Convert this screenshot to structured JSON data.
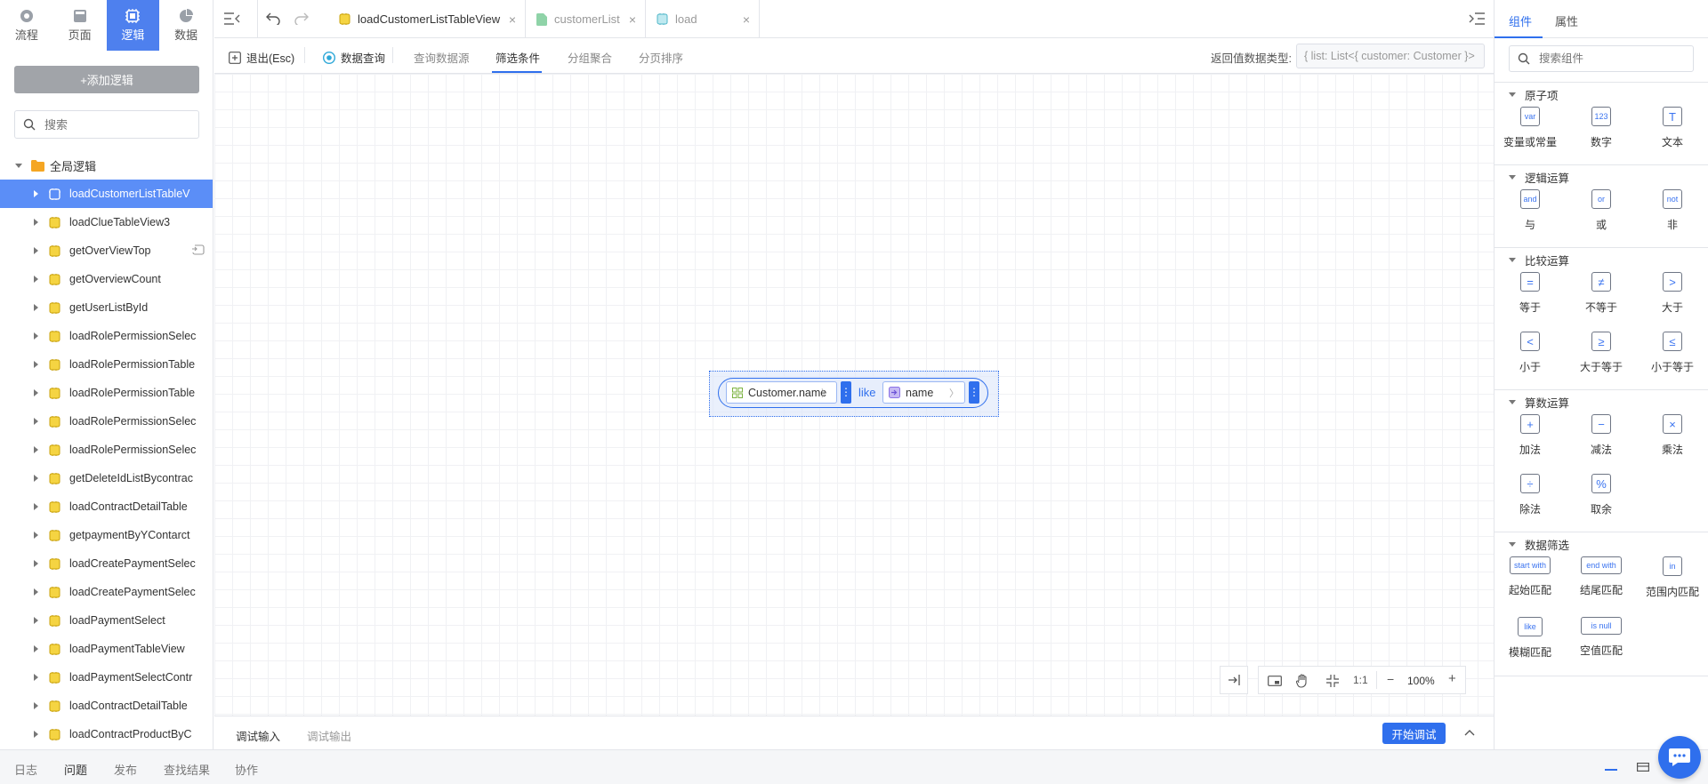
{
  "mode_tabs": [
    {
      "label": "流程",
      "icon": "flow-icon"
    },
    {
      "label": "页面",
      "icon": "page-icon"
    },
    {
      "label": "逻辑",
      "icon": "logic-icon"
    },
    {
      "label": "数据",
      "icon": "data-icon"
    }
  ],
  "left_panel": {
    "add_logic_label": "+添加逻辑",
    "search_placeholder": "搜索",
    "tree_root": "全局逻辑",
    "items": [
      "loadCustomerListTableV",
      "loadClueTableView3",
      "getOverViewTop",
      "getOverviewCount",
      "getUserListById",
      "loadRolePermissionSelec",
      "loadRolePermissionTable",
      "loadRolePermissionTable",
      "loadRolePermissionSelec",
      "loadRolePermissionSelec",
      "getDeleteIdListBycontrac",
      "loadContractDetailTable",
      "getpaymentByYContarct",
      "loadCreatePaymentSelec",
      "loadCreatePaymentSelec",
      "loadPaymentSelect",
      "loadPaymentTableView",
      "loadPaymentSelectContr",
      "loadContractDetailTable",
      "loadContractProductByC"
    ]
  },
  "editor_tabs": [
    {
      "label": "loadCustomerListTableView",
      "close": "×"
    },
    {
      "label": "customerList",
      "close": "×"
    },
    {
      "label": "load",
      "close": "×"
    }
  ],
  "toolbar": {
    "exit_label": "退出(Esc)",
    "data_query_label": "数据查询",
    "query_source_label": "查询数据源",
    "filter_label": "筛选条件",
    "group_label": "分组聚合",
    "sort_label": "分页排序",
    "return_type_label": "返回值数据类型:",
    "return_type_value": "{ list: List<{ customer: Customer }>"
  },
  "canvas": {
    "left_operand": "Customer.name",
    "operator": "like",
    "right_operand": "name",
    "zoom": "100%",
    "one_to_one": "1:1"
  },
  "debug": {
    "input_tab": "调试输入",
    "output_tab": "调试输出",
    "start_label": "开始调试"
  },
  "status_tabs": [
    "日志",
    "问题",
    "发布",
    "查找结果",
    "协作"
  ],
  "right_panel": {
    "tabs": [
      "组件",
      "属性"
    ],
    "search_placeholder": "搜索组件",
    "sections": [
      {
        "title": "原子项",
        "items": [
          {
            "glyph": "var",
            "label": "变量或常量"
          },
          {
            "glyph": "123",
            "label": "数字"
          },
          {
            "glyph": "T",
            "label": "文本"
          }
        ]
      },
      {
        "title": "逻辑运算",
        "items": [
          {
            "glyph": "and",
            "label": "与"
          },
          {
            "glyph": "or",
            "label": "或"
          },
          {
            "glyph": "not",
            "label": "非"
          }
        ]
      },
      {
        "title": "比较运算",
        "items": [
          {
            "glyph": "=",
            "label": "等于"
          },
          {
            "glyph": "≠",
            "label": "不等于"
          },
          {
            "glyph": ">",
            "label": "大于"
          },
          {
            "glyph": "<",
            "label": "小于"
          },
          {
            "glyph": "≥",
            "label": "大于等于"
          },
          {
            "glyph": "≤",
            "label": "小于等于"
          }
        ]
      },
      {
        "title": "算数运算",
        "items": [
          {
            "glyph": "+",
            "label": "加法"
          },
          {
            "glyph": "−",
            "label": "减法"
          },
          {
            "glyph": "×",
            "label": "乘法"
          },
          {
            "glyph": "÷",
            "label": "除法"
          },
          {
            "glyph": "%",
            "label": "取余"
          }
        ]
      },
      {
        "title": "数据筛选",
        "items": [
          {
            "glyph": "start with",
            "label": "起始匹配"
          },
          {
            "glyph": "end with",
            "label": "结尾匹配"
          },
          {
            "glyph": "in",
            "label": "范围内匹配"
          },
          {
            "glyph": "like",
            "label": "模糊匹配"
          },
          {
            "glyph": "is null",
            "label": "空值匹配"
          }
        ]
      }
    ]
  },
  "colors": {
    "accent": "#4e80ee",
    "active_tree": "#5b8ef7",
    "debug_button": "#2f6fed"
  }
}
